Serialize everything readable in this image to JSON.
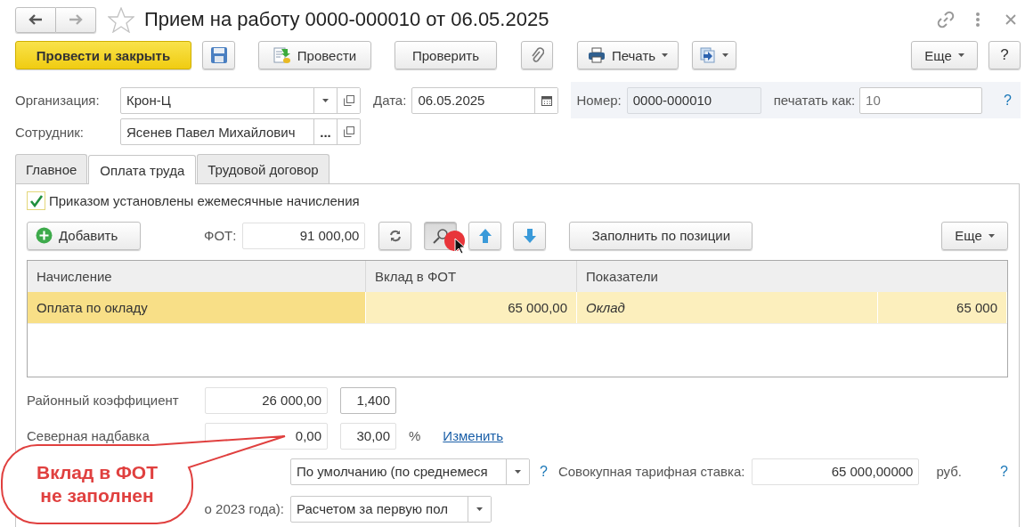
{
  "window": {
    "title": "Прием на работу 0000-000010 от 06.05.2025"
  },
  "command_bar": {
    "post_and_close": "Провести и закрыть",
    "post": "Провести",
    "check": "Проверить",
    "print": "Печать",
    "more": "Еще",
    "help": "?"
  },
  "header": {
    "organization": {
      "label": "Организация:",
      "value": "Крон-Ц"
    },
    "date": {
      "label": "Дата:",
      "value": "06.05.2025"
    },
    "number": {
      "label": "Номер:",
      "value": "0000-000010"
    },
    "print_as": {
      "label": "печатать как:",
      "placeholder": "10"
    },
    "help": "?",
    "employee": {
      "label": "Сотрудник:",
      "value": "Ясенев Павел Михайлович",
      "more": "..."
    }
  },
  "tabs": [
    {
      "label": "Главное",
      "selected": false
    },
    {
      "label": "Оплата труда",
      "selected": true
    },
    {
      "label": "Трудовой договор",
      "selected": false
    }
  ],
  "monthly_accruals": {
    "label": "Приказом установлены ежемесячные начисления",
    "checked": true
  },
  "accruals_toolbar": {
    "add": "Добавить",
    "fot_label": "ФОТ:",
    "fot_value": "91 000,00",
    "find_pressed": true,
    "fill": "Заполнить по позиции",
    "more": "Еще"
  },
  "table": {
    "columns": [
      "Начисление",
      "Вклад в ФОТ",
      "Показатели"
    ],
    "rows": [
      {
        "cells": [
          "Оплата по окладу",
          "65 000,00",
          "Оклад",
          "65 000"
        ],
        "selected": true
      }
    ]
  },
  "regional_coefficient": {
    "label": "Районный коэффициент",
    "amount": "26 000,00",
    "rate": "1,400"
  },
  "northern_allowance": {
    "label": "Северная надбавка",
    "amount": "0,00",
    "rate": "30,00",
    "unit": "%",
    "link": "Изменить"
  },
  "rate_method": {
    "value": "По умолчанию (по среднемеся",
    "help": "?"
  },
  "total_rate": {
    "label": "Совокупная тарифная ставка:",
    "value": "65 000,00000",
    "unit": "руб.",
    "help": "?"
  },
  "average_earnings": {
    "label": "о 2023 года):",
    "value": "Расчетом за первую пол"
  },
  "callout": {
    "text": "Вклад в ФОТ не заполнен"
  }
}
